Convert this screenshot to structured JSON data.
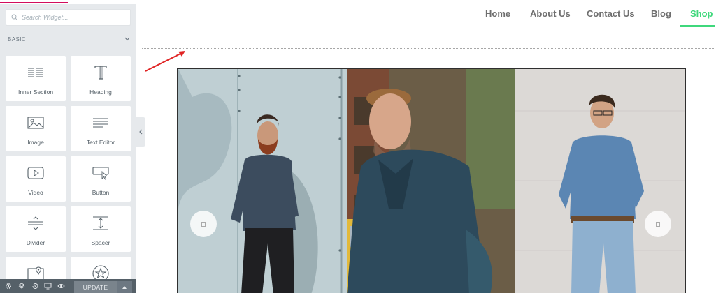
{
  "panel": {
    "search_placeholder": "Search Widget...",
    "category": "BASIC",
    "widgets": [
      {
        "label": "Inner Section",
        "icon": "inner-section-icon"
      },
      {
        "label": "Heading",
        "icon": "heading-icon"
      },
      {
        "label": "Image",
        "icon": "image-icon"
      },
      {
        "label": "Text Editor",
        "icon": "text-editor-icon"
      },
      {
        "label": "Video",
        "icon": "video-icon"
      },
      {
        "label": "Button",
        "icon": "button-icon"
      },
      {
        "label": "Divider",
        "icon": "divider-icon"
      },
      {
        "label": "Spacer",
        "icon": "spacer-icon"
      },
      {
        "label": "",
        "icon": "google-maps-icon"
      },
      {
        "label": "",
        "icon": "star-icon"
      }
    ],
    "bottom_icons": [
      "settings-icon",
      "layers-icon",
      "history-icon",
      "responsive-icon",
      "preview-icon"
    ],
    "update_label": "UPDATE"
  },
  "nav": {
    "items": [
      "Home",
      "About Us",
      "Contact Us",
      "Blog",
      "Shop"
    ],
    "active": "Shop"
  },
  "colors": {
    "accent": "#d30c5c",
    "active_nav": "#3fd87c",
    "arrow": "#e02424"
  }
}
